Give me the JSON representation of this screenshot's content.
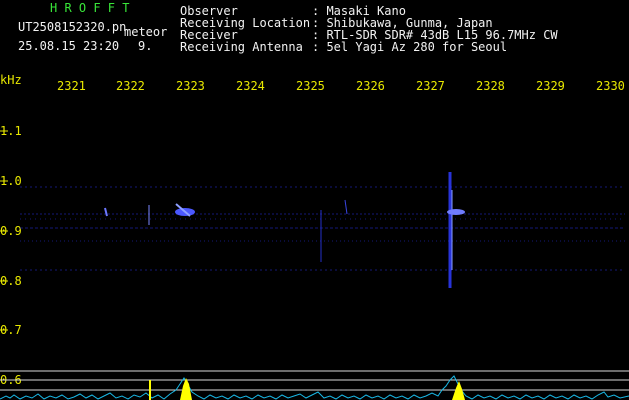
{
  "header": {
    "brand": "H R O F F T",
    "filename": "UT2508152320.pn",
    "tag": "meteor",
    "datetime": "25.08.15 23:20",
    "count": "9.",
    "rows": [
      {
        "label": "Observer",
        "value": ": Masaki Kano"
      },
      {
        "label": "Receiving Location",
        "value": ": Shibukawa, Gunma, Japan"
      },
      {
        "label": "Receiver",
        "value": ": RTL-SDR SDR# 43dB L15 96.7MHz CW"
      },
      {
        "label": "Receiving Antenna",
        "value": ": 5el Yagi Az 280 for Seoul"
      }
    ]
  },
  "axes": {
    "y_unit": "kHz",
    "y_ticks": [
      "1.1",
      "1.0",
      "0.9",
      "0.8",
      "0.7",
      "0.6"
    ],
    "x_ticks": [
      "2321",
      "2322",
      "2323",
      "2324",
      "2325",
      "2326",
      "2327",
      "2328",
      "2329",
      "2330"
    ]
  },
  "colors": {
    "background": "#000000",
    "header_green": "#39e639",
    "axis_yellow": "#e8e800",
    "signal_blue": "#3a46ff",
    "spectrum_cyan": "#19b8e6",
    "peak_yellow": "#ffff00"
  }
}
